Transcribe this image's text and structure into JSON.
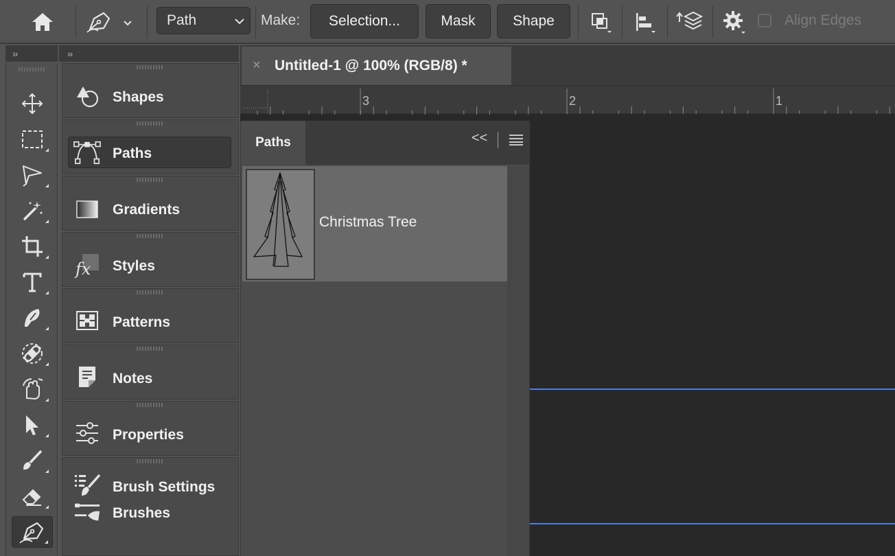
{
  "options_bar": {
    "mode_value": "Path",
    "make_label": "Make:",
    "selection_button": "Selection...",
    "mask_button": "Mask",
    "shape_button": "Shape",
    "align_edges_label": "Align Edges",
    "align_edges_checked": false
  },
  "tools_column": {
    "collapse_glyph": "››"
  },
  "panel_dock": {
    "collapse_glyph": "››",
    "items": [
      {
        "label": "Shapes",
        "icon": "shapes-icon"
      },
      {
        "label": "Paths",
        "icon": "paths-icon",
        "active": true
      },
      {
        "label": "Gradients",
        "icon": "gradients-icon"
      },
      {
        "label": "Styles",
        "icon": "styles-icon"
      },
      {
        "label": "Patterns",
        "icon": "patterns-icon"
      },
      {
        "label": "Notes",
        "icon": "notes-icon"
      },
      {
        "label": "Properties",
        "icon": "properties-icon"
      },
      {
        "label": "Brush Settings",
        "icon": "brush-settings-icon"
      },
      {
        "label": "Brushes",
        "icon": "brushes-icon"
      }
    ]
  },
  "document": {
    "tab_close_glyph": "×",
    "tab_title": "Untitled-1 @ 100% (RGB/8) *",
    "ruler_numbers": [
      "3",
      "2",
      "1"
    ]
  },
  "paths_panel": {
    "tab_label": "Paths",
    "collapse_glyph": "<<",
    "paths": [
      {
        "name": "Christmas Tree"
      }
    ]
  },
  "colors": {
    "ui_background": "#535353",
    "panel_dark": "#3b3b3b",
    "canvas": "#282828",
    "guide_line": "#4a82e0",
    "selected_row": "#696969"
  }
}
